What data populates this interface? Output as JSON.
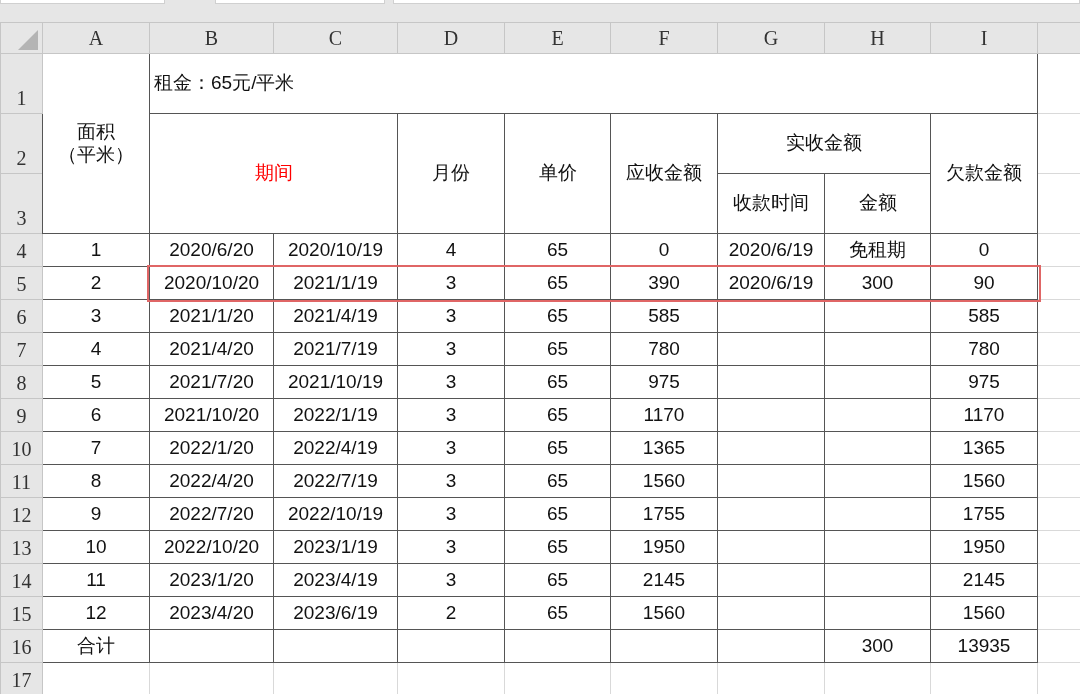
{
  "column_headers": [
    "A",
    "B",
    "C",
    "D",
    "E",
    "F",
    "G",
    "H",
    "I"
  ],
  "row_numbers": [
    "1",
    "2",
    "3",
    "4",
    "5",
    "6",
    "7",
    "8",
    "9",
    "10",
    "11",
    "12",
    "13",
    "14",
    "15",
    "16",
    "17"
  ],
  "rent_note": "租金：65元/平米",
  "headers": {
    "area": [
      "面积",
      "（平米）"
    ],
    "period": {
      "text": "期间",
      "color": "#ff0000"
    },
    "months": "月份",
    "price": "单价",
    "due": "应收金额",
    "received": "实收金额",
    "paid_date": "收款时间",
    "paid_amount": "金额",
    "owed": "欠款金额"
  },
  "rows": [
    {
      "no": "1",
      "start": "2020/6/20",
      "end": "2020/10/19",
      "months": "4",
      "price": "65",
      "due": "0",
      "paid_date": "2020/6/19",
      "paid_amount": "免租期",
      "owed": "0",
      "highlighted": false
    },
    {
      "no": "2",
      "start": "2020/10/20",
      "end": "2021/1/19",
      "months": "3",
      "price": "65",
      "due": "390",
      "paid_date": "2020/6/19",
      "paid_amount": "300",
      "owed": "90",
      "highlighted": true
    },
    {
      "no": "3",
      "start": "2021/1/20",
      "end": "2021/4/19",
      "months": "3",
      "price": "65",
      "due": "585",
      "owed": "585",
      "highlighted": false
    },
    {
      "no": "4",
      "start": "2021/4/20",
      "end": "2021/7/19",
      "months": "3",
      "price": "65",
      "due": "780",
      "owed": "780",
      "highlighted": false
    },
    {
      "no": "5",
      "start": "2021/7/20",
      "end": "2021/10/19",
      "months": "3",
      "price": "65",
      "due": "975",
      "owed": "975",
      "highlighted": false
    },
    {
      "no": "6",
      "start": "2021/10/20",
      "end": "2022/1/19",
      "months": "3",
      "price": "65",
      "due": "1170",
      "owed": "1170",
      "highlighted": false
    },
    {
      "no": "7",
      "start": "2022/1/20",
      "end": "2022/4/19",
      "months": "3",
      "price": "65",
      "due": "1365",
      "owed": "1365",
      "highlighted": false
    },
    {
      "no": "8",
      "start": "2022/4/20",
      "end": "2022/7/19",
      "months": "3",
      "price": "65",
      "due": "1560",
      "owed": "1560",
      "highlighted": false
    },
    {
      "no": "9",
      "start": "2022/7/20",
      "end": "2022/10/19",
      "months": "3",
      "price": "65",
      "due": "1755",
      "owed": "1755",
      "highlighted": false
    },
    {
      "no": "10",
      "start": "2022/10/20",
      "end": "2023/1/19",
      "months": "3",
      "price": "65",
      "due": "1950",
      "owed": "1950",
      "highlighted": false
    },
    {
      "no": "11",
      "start": "2023/1/20",
      "end": "2023/4/19",
      "months": "3",
      "price": "65",
      "due": "2145",
      "owed": "2145",
      "highlighted": false
    },
    {
      "no": "12",
      "start": "2023/4/20",
      "end": "2023/6/19",
      "months": "2",
      "price": "65",
      "due": "1560",
      "owed": "1560",
      "highlighted": false
    }
  ],
  "total": {
    "label": "合计",
    "paid_amount": "300",
    "owed": "13935"
  }
}
